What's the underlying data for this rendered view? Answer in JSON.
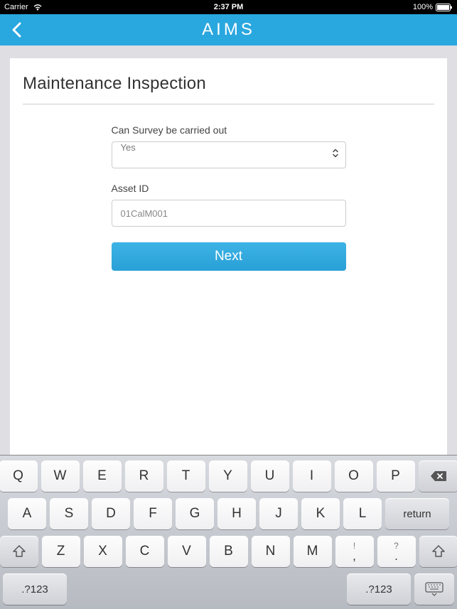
{
  "status": {
    "carrier": "Carrier",
    "time": "2:37 PM",
    "battery": "100%"
  },
  "nav": {
    "title": "AIMS"
  },
  "page": {
    "title": "Maintenance Inspection"
  },
  "form": {
    "survey": {
      "label": "Can Survey be carried out",
      "value": "Yes"
    },
    "asset": {
      "label": "Asset ID",
      "value": "01CalM001"
    },
    "next_label": "Next"
  },
  "keyboard": {
    "row1": [
      "Q",
      "W",
      "E",
      "R",
      "T",
      "Y",
      "U",
      "I",
      "O",
      "P"
    ],
    "row2": [
      "A",
      "S",
      "D",
      "F",
      "G",
      "H",
      "J",
      "K",
      "L"
    ],
    "row3_letters": [
      "Z",
      "X",
      "C",
      "V",
      "B",
      "N",
      "M"
    ],
    "row3_punct": [
      "!",
      ",",
      "?",
      "."
    ],
    "return_label": "return",
    "numsym_label": ".?123"
  }
}
